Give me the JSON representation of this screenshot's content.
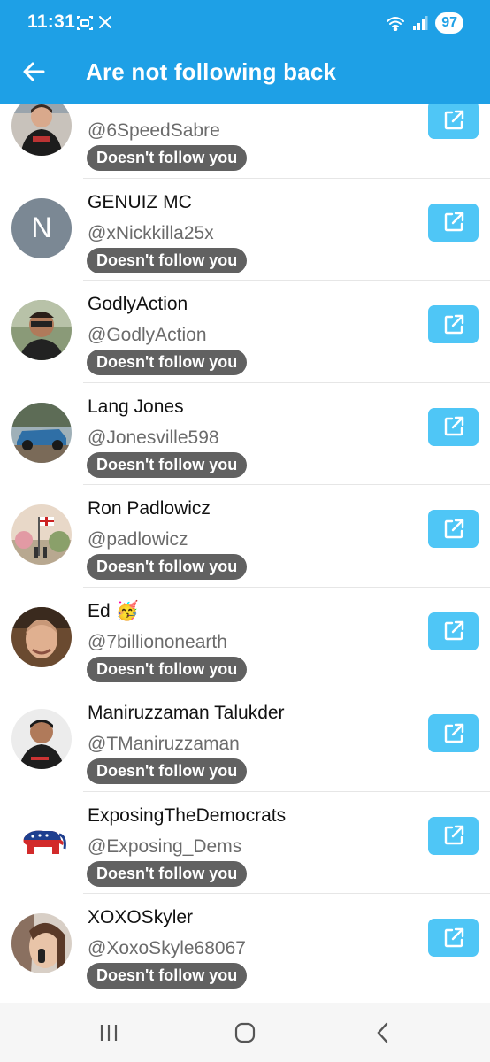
{
  "status_bar": {
    "time": "11:31",
    "battery": "97",
    "icons": [
      "screenshot-icon",
      "x-logo-icon",
      "wifi-icon",
      "signal-icon"
    ]
  },
  "app_bar": {
    "title": "Are not following back",
    "back_icon": "arrow-left-icon"
  },
  "colors": {
    "app_bar": "#1ea0e6",
    "badge": "#616161",
    "open_button": "#4fc6f6",
    "handle_text": "#6b6b6b"
  },
  "users": [
    {
      "name": "",
      "handle": "@6SpeedSabre",
      "badge": "Doesn't follow you"
    },
    {
      "name": "GENUIZ MC",
      "handle": "@xNickkilla25x",
      "badge": "Doesn't follow you",
      "avatar_letter": "N"
    },
    {
      "name": "GodlyAction",
      "handle": "@GodlyAction",
      "badge": "Doesn't follow you"
    },
    {
      "name": "Lang Jones",
      "handle": "@Jonesville598",
      "badge": "Doesn't follow you"
    },
    {
      "name": "Ron Padlowicz",
      "handle": "@padlowicz",
      "badge": "Doesn't follow you"
    },
    {
      "name": "Ed 🥳",
      "handle": "@7billiononearth",
      "badge": "Doesn't follow you"
    },
    {
      "name": "Maniruzzaman Talukder",
      "handle": "@TManiruzzaman",
      "badge": "Doesn't follow you"
    },
    {
      "name": "ExposingTheDemocrats",
      "handle": "@Exposing_Dems",
      "badge": "Doesn't follow you"
    },
    {
      "name": "XOXOSkyler",
      "handle": "@XoxoSkyle68067",
      "badge": "Doesn't follow you"
    }
  ],
  "nav_bar": {
    "icons": [
      "recent-apps-icon",
      "home-icon",
      "back-icon"
    ]
  }
}
